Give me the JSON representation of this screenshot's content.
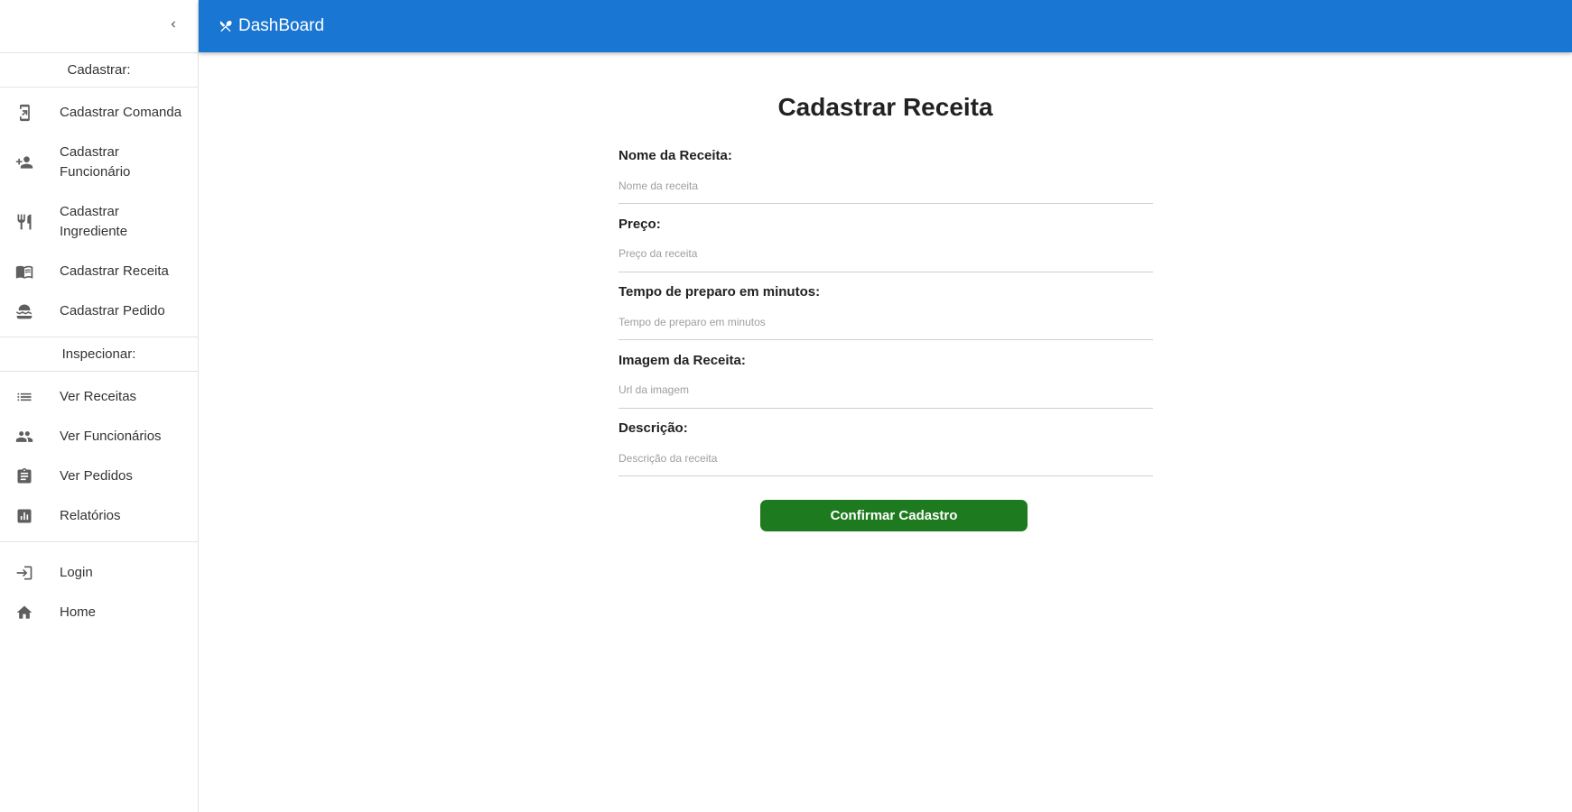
{
  "appbar": {
    "title": "DashBoard",
    "icon": "utensils-icon",
    "background_color": "#1976d2"
  },
  "sidebar": {
    "collapse_icon": "chevron-left-icon",
    "sections": [
      {
        "header": "Cadastrar:",
        "items": [
          {
            "label": "Cadastrar Comanda",
            "icon": "tablet-enter-icon"
          },
          {
            "label": "Cadastrar Funcionário",
            "icon": "person-add-icon"
          },
          {
            "label": "Cadastrar Ingrediente",
            "icon": "fork-knife-icon"
          },
          {
            "label": "Cadastrar Receita",
            "icon": "menu-book-icon"
          },
          {
            "label": "Cadastrar Pedido",
            "icon": "lunch-dining-icon"
          }
        ]
      },
      {
        "header": "Inspecionar:",
        "items": [
          {
            "label": "Ver Receitas",
            "icon": "list-icon"
          },
          {
            "label": "Ver Funcionários",
            "icon": "people-icon"
          },
          {
            "label": "Ver Pedidos",
            "icon": "clipboard-icon"
          },
          {
            "label": "Relatórios",
            "icon": "bar-chart-icon"
          }
        ]
      },
      {
        "header": "",
        "items": [
          {
            "label": "Login",
            "icon": "login-icon"
          },
          {
            "label": "Home",
            "icon": "home-icon"
          }
        ]
      }
    ]
  },
  "main": {
    "title": "Cadastrar Receita",
    "fields": [
      {
        "label": "Nome da Receita:",
        "placeholder": "Nome da receita",
        "value": ""
      },
      {
        "label": "Preço:",
        "placeholder": "Preço da receita",
        "value": ""
      },
      {
        "label": "Tempo de preparo em minutos:",
        "placeholder": "Tempo de preparo em minutos",
        "value": ""
      },
      {
        "label": "Imagem da Receita:",
        "placeholder": "Url da imagem",
        "value": ""
      },
      {
        "label": "Descrição:",
        "placeholder": "Descrição da receita",
        "value": ""
      }
    ],
    "submit_label": "Confirmar Cadastro",
    "submit_color": "#1e7a1e"
  }
}
